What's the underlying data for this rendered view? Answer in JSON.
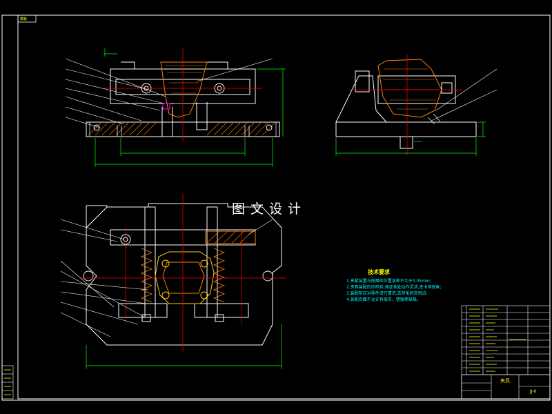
{
  "drawing": {
    "corner_tag": "模板",
    "watermark": "图文设计",
    "technical_requirements": {
      "title": "技术要求",
      "items": [
        "1.夹紧装置与底面的位置误差不大于0.05mm;",
        "2.夹具装配后应检验,保证各处动作灵活,无卡滞现象;",
        "3.装配前应对零件进行清洗,去除毛刺及锐边;",
        "4.各配合面不允许有损伤、锈蚀等缺陷。"
      ]
    },
    "title_block": {
      "name": "夹具",
      "code": "JJ-0"
    },
    "colors": {
      "background": "#000000",
      "outline": "#ffffff",
      "center_line": "#ff0000",
      "dimension": "#00ff00",
      "hatch": "#ff8000",
      "leader": "#ffffff"
    }
  }
}
